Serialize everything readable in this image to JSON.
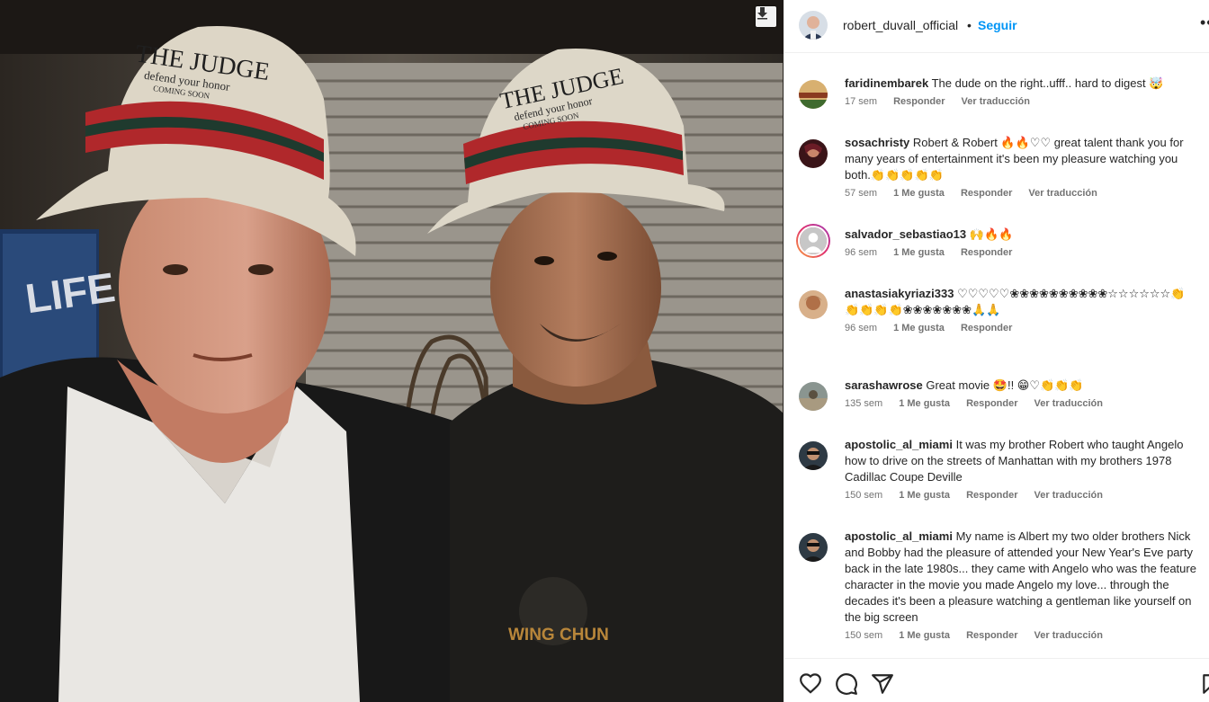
{
  "photo": {
    "hat_text_line1": "THE JUDGE",
    "hat_text_line2": "defend your honor",
    "hat_text_line3": "COMING SOON",
    "sign_text": "LIFE",
    "shirt_text": "WING CHUN",
    "download_icon": "download-icon"
  },
  "header": {
    "username": "robert_duvall_official",
    "dot": "•",
    "follow_label": "Seguir",
    "more_icon": "more-options-icon"
  },
  "comments": [
    {
      "user": "faridinembarek",
      "text": "The dude on the right..ufff.. hard to digest 🤯",
      "time": "17 sem",
      "likes": "",
      "reply": "Responder",
      "translate": "Ver traducción",
      "avatar_color": "#c88a3c"
    },
    {
      "user": "sosachristy",
      "text": "Robert & Robert 🔥🔥♡♡ great talent thank you for many years of entertainment it's been my pleasure watching you both.👏👏👏👏👏",
      "time": "57 sem",
      "likes": "1 Me gusta",
      "reply": "Responder",
      "translate": "Ver traducción",
      "avatar_color": "#6a1e2a"
    },
    {
      "user": "salvador_sebastiao13",
      "text": "🙌🔥🔥",
      "time": "96 sem",
      "likes": "1 Me gusta",
      "reply": "Responder",
      "translate": "",
      "avatar_color": "#c7c7c7"
    },
    {
      "user": "anastasiakyriazi333",
      "text": "♡♡♡♡♡❀❀❀❀❀❀❀❀❀❀☆☆☆☆☆☆👏👏👏👏👏❀❀❀❀❀❀❀🙏🙏",
      "time": "96 sem",
      "likes": "1 Me gusta",
      "reply": "Responder",
      "translate": "",
      "avatar_color": "#a86a3e"
    },
    {
      "user": "sarashawrose",
      "text": "Great movie 🤩!! 😁♡👏👏👏",
      "time": "135 sem",
      "likes": "1 Me gusta",
      "reply": "Responder",
      "translate": "Ver traducción",
      "avatar_color": "#7a8a8a"
    },
    {
      "user": "apostolic_al_miami",
      "text": "It was my brother Robert who taught Angelo how to drive on the streets of Manhattan with my brothers 1978 Cadillac Coupe Deville",
      "time": "150 sem",
      "likes": "1 Me gusta",
      "reply": "Responder",
      "translate": "Ver traducción",
      "avatar_color": "#3a5a78"
    },
    {
      "user": "apostolic_al_miami",
      "text": "My name is Albert my two older brothers Nick and Bobby had the pleasure of attended your New Year's Eve party back in the late 1980s... they came with Angelo who was the feature character in the movie you made Angelo my love... through the decades it's been a pleasure watching a gentleman like yourself on the big screen",
      "time": "150 sem",
      "likes": "1 Me gusta",
      "reply": "Responder",
      "translate": "Ver traducción",
      "avatar_color": "#3a5a78"
    }
  ],
  "actions": {
    "like_icon": "heart-icon",
    "comment_icon": "comment-icon",
    "share_icon": "share-icon",
    "save_icon": "bookmark-icon"
  },
  "colors": {
    "accent": "#0095f6",
    "text": "#262626",
    "meta": "#737373",
    "divider": "#efefef"
  }
}
